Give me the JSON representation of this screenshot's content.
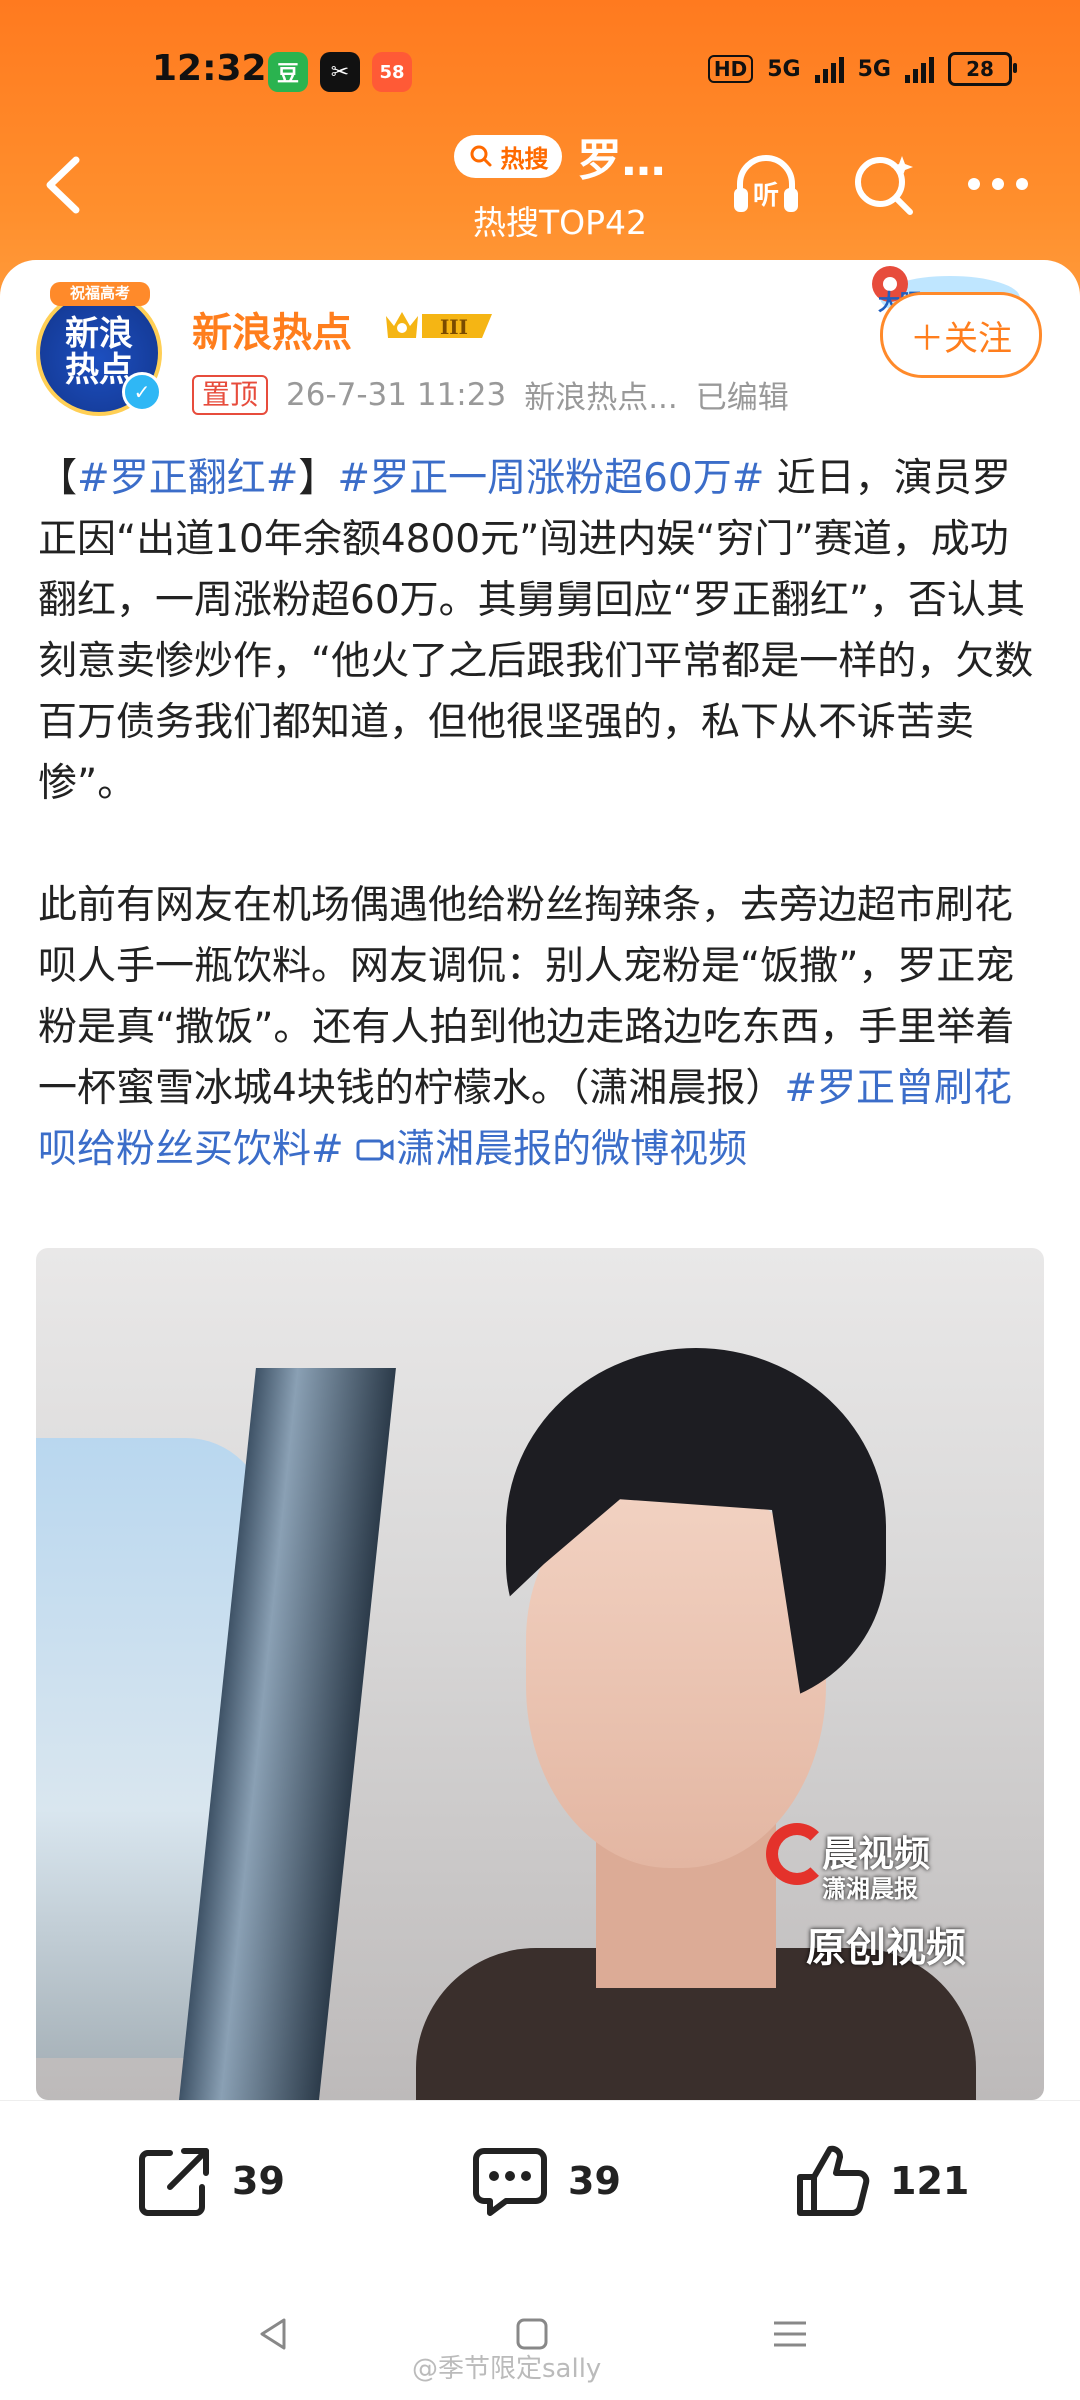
{
  "status_bar": {
    "time": "12:32",
    "apps": [
      {
        "icon": "douban-app-icon",
        "label": "豆",
        "color": "#2ab34f"
      },
      {
        "icon": "capcut-app-icon",
        "label": "✂",
        "color": "#111111"
      },
      {
        "icon": "58-app-icon",
        "label": "58",
        "color": "#ff5a36"
      }
    ],
    "hd_label": "HD",
    "network_1": "5G",
    "network_2": "5G",
    "battery": "28"
  },
  "header": {
    "hot_badge": "热搜",
    "hot_word": "罗…",
    "subtitle": "热搜TOP42",
    "listen_label": "听"
  },
  "post": {
    "author": "新浪热点",
    "avatar_text_1": "新浪",
    "avatar_text_2": "热点",
    "avatar_banner": "祝福高考",
    "level": "III",
    "pin_label": "置顶",
    "date": "26-7-31 11:23",
    "source": "新浪热点...",
    "edited": "已编辑",
    "follow_label": "＋关注",
    "follow_deco": "大眼",
    "p1_prefix": "【",
    "p1_tag1": "#罗正翻红#",
    "p1_bracket_end": "】",
    "p1_tag2": "#罗正一周涨粉超60万#",
    "p1_text": " 近日，演员罗正因“出道10年余额4800元”闯进内娱“穷门”赛道，成功翻红，一周涨粉超60万。其舅舅回应“罗正翻红”，否认其刻意卖惨炒作，“他火了之后跟我们平常都是一样的，欠数百万债务我们都知道，但他很坚强的，私下从不诉苦卖惨”。",
    "p2_text": "此前有网友在机场偶遇他给粉丝掏辣条，去旁边超市刷花呗人手一瓶饮料。网友调侃：别人宠粉是“饭撒”，罗正宠粉是真“撒饭”。还有人拍到他边走路边吃东西，手里举着一杯蜜雪冰城4块钱的柠檬水。（潇湘晨报）",
    "p2_tag": "#罗正曾刷花呗给粉丝买饮料#",
    "video_link_icon": "video-camera-icon",
    "video_link": "潇湘晨报的微博视频"
  },
  "video": {
    "watermark_1": "晨视频",
    "watermark_2": "潇湘晨报",
    "watermark_3": "原创视频"
  },
  "actions": {
    "share_count": "39",
    "comment_count": "39",
    "like_count": "121"
  },
  "footer": {
    "credit": "@季节限定sally"
  },
  "colors": {
    "accent": "#ff7e1d",
    "topic_link": "#3b6dc9",
    "header_bg": "#ff8a2a"
  }
}
